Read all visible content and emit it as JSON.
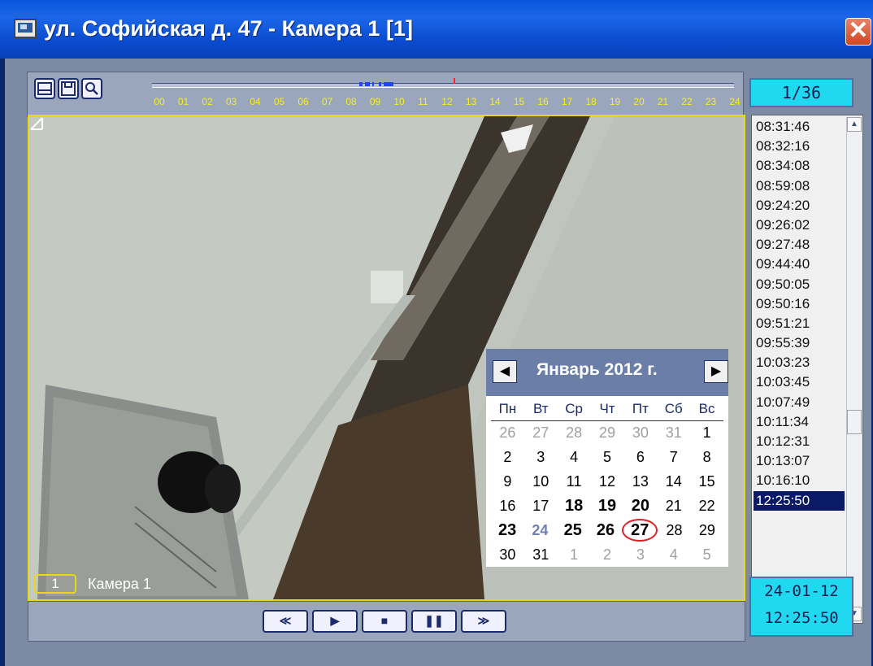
{
  "window": {
    "title": "ул. Софийская д. 47 - Камера 1 [1]",
    "close_glyph": "✕"
  },
  "toolbar": {
    "buttons": [
      "print-icon",
      "save-icon",
      "zoom-icon"
    ]
  },
  "timeline": {
    "hours": [
      "00",
      "01",
      "02",
      "03",
      "04",
      "05",
      "06",
      "07",
      "08",
      "09",
      "10",
      "11",
      "12",
      "13",
      "14",
      "15",
      "16",
      "17",
      "18",
      "19",
      "20",
      "21",
      "22",
      "23",
      "24"
    ]
  },
  "counter": "1/36",
  "camera": {
    "number": "1",
    "name": "Камера 1"
  },
  "calendar": {
    "title": "Январь 2012 г.",
    "prev": "◀",
    "next": "▶",
    "day_names": [
      "Пн",
      "Вт",
      "Ср",
      "Чт",
      "Пт",
      "Сб",
      "Вс"
    ],
    "weeks": [
      [
        "26",
        "27",
        "28",
        "29",
        "30",
        "31",
        "1"
      ],
      [
        "2",
        "3",
        "4",
        "5",
        "6",
        "7",
        "8"
      ],
      [
        "9",
        "10",
        "11",
        "12",
        "13",
        "14",
        "15"
      ],
      [
        "16",
        "17",
        "18",
        "19",
        "20",
        "21",
        "22"
      ],
      [
        "23",
        "24",
        "25",
        "26",
        "27",
        "28",
        "29"
      ],
      [
        "30",
        "31",
        "1",
        "2",
        "3",
        "4",
        "5"
      ]
    ]
  },
  "times": [
    "08:31:46",
    "08:32:16",
    "08:34:08",
    "08:59:08",
    "09:24:20",
    "09:26:02",
    "09:27:48",
    "09:44:40",
    "09:50:05",
    "09:50:16",
    "09:51:21",
    "09:55:39",
    "10:03:23",
    "10:03:45",
    "10:07:49",
    "10:11:34",
    "10:12:31",
    "10:13:07",
    "10:16:10",
    "12:25:50"
  ],
  "selected_time": "12:25:50",
  "datetime": {
    "date": "24-01-12",
    "time": "12:25:50"
  },
  "playback": {
    "buttons": [
      "rewind-icon",
      "play-icon",
      "stop-icon",
      "pause-icon",
      "forward-icon"
    ],
    "labels": [
      "≪",
      "▶",
      "■",
      "❚❚",
      "≫"
    ]
  },
  "colors": {
    "accent": "#20d8f0",
    "frame": "#e8d818",
    "selected": "#0a1a66"
  }
}
